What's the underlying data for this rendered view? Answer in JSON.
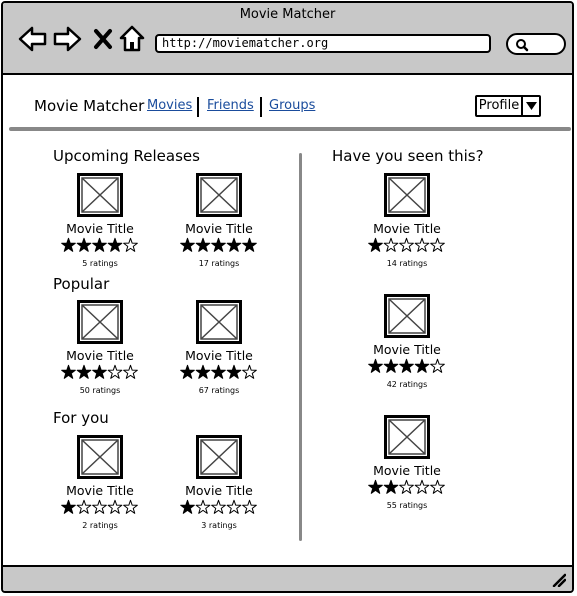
{
  "window": {
    "title": "Movie Matcher"
  },
  "browser": {
    "url": "http://moviematcher.org"
  },
  "header": {
    "brand": "Movie Matcher",
    "nav": [
      "Movies",
      "Friends",
      "Groups"
    ],
    "profile_label": "Profile"
  },
  "sections": {
    "upcoming": {
      "title": "Upcoming Releases",
      "movies": [
        {
          "title": "Movie Title",
          "stars": 4,
          "ratings": "5 ratings"
        },
        {
          "title": "Movie Title",
          "stars": 5,
          "ratings": "17 ratings"
        }
      ]
    },
    "popular": {
      "title": "Popular",
      "movies": [
        {
          "title": "Movie Title",
          "stars": 3,
          "ratings": "50 ratings"
        },
        {
          "title": "Movie Title",
          "stars": 4,
          "ratings": "67 ratings"
        }
      ]
    },
    "foryou": {
      "title": "For you",
      "movies": [
        {
          "title": "Movie Title",
          "stars": 1,
          "ratings": "2 ratings"
        },
        {
          "title": "Movie Title",
          "stars": 1,
          "ratings": "3 ratings"
        }
      ]
    },
    "seen": {
      "title": "Have you seen this?",
      "movies": [
        {
          "title": "Movie Title",
          "stars": 1,
          "ratings": "14 ratings"
        },
        {
          "title": "Movie Title",
          "stars": 4,
          "ratings": "42 ratings"
        },
        {
          "title": "Movie Title",
          "stars": 2,
          "ratings": "55 ratings"
        }
      ]
    }
  }
}
